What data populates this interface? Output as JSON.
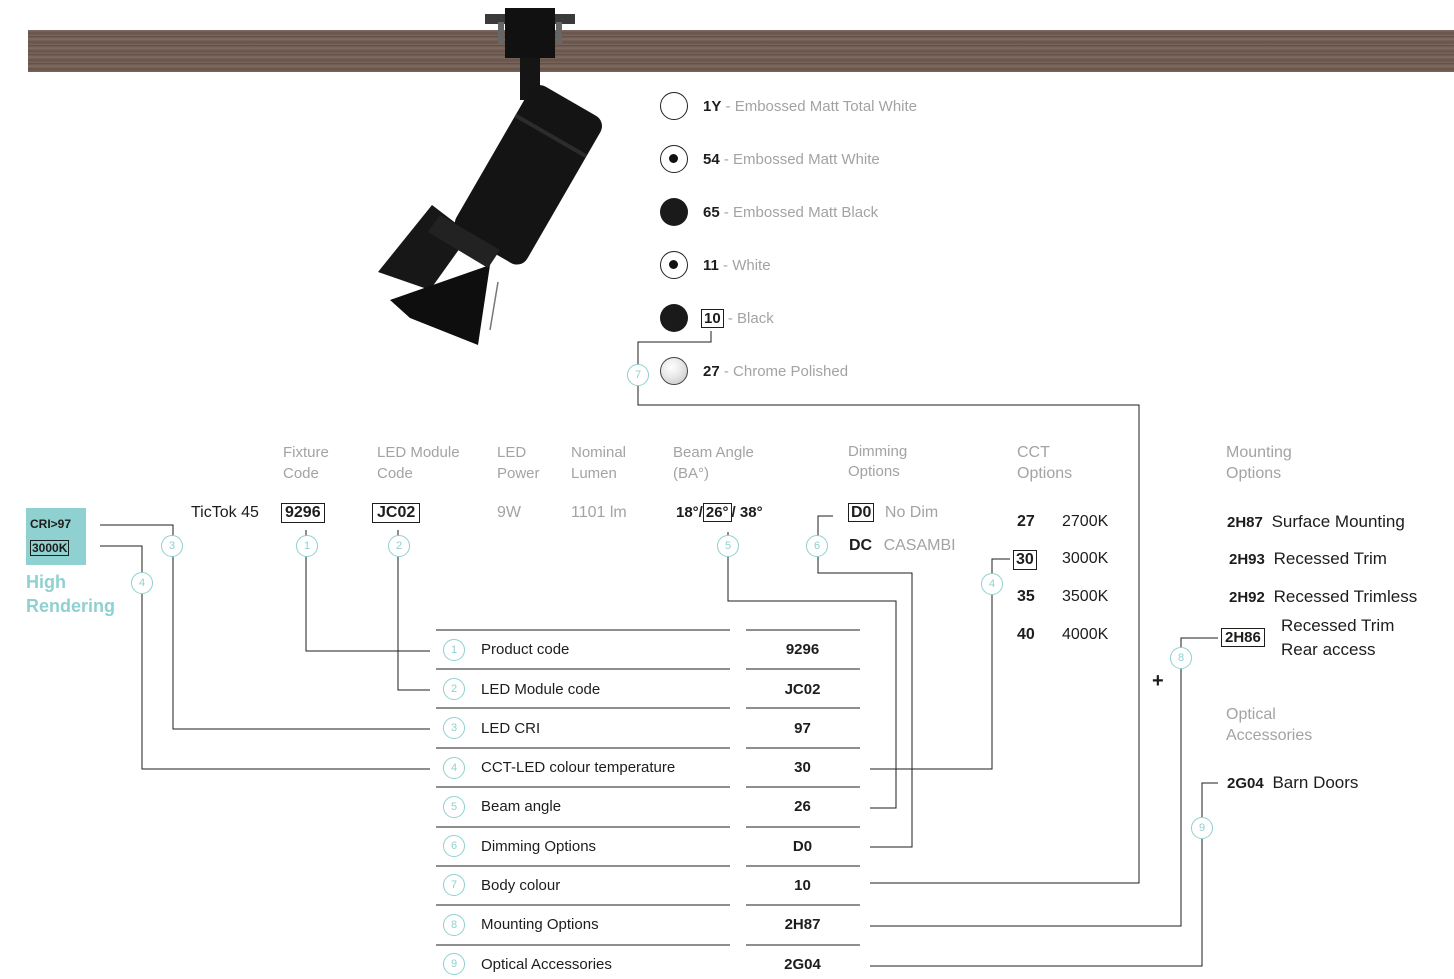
{
  "colours": [
    {
      "code": "1Y",
      "sep": "-",
      "name": "Embossed Matt Total White",
      "swatch": "white"
    },
    {
      "code": "54",
      "sep": "-",
      "name": "Embossed Matt White",
      "swatch": "dot"
    },
    {
      "code": "65",
      "sep": "-",
      "name": "Embossed Matt Black",
      "swatch": "black"
    },
    {
      "code": "11",
      "sep": "-",
      "name": "White",
      "swatch": "dot"
    },
    {
      "code": "10",
      "sep": "-",
      "name": "Black",
      "swatch": "black",
      "boxed": true
    },
    {
      "code": "27",
      "sep": "-",
      "name": "Chrome Polished",
      "swatch": "chrome"
    }
  ],
  "headers": {
    "fixture_code": [
      "Fixture",
      "Code"
    ],
    "led_module_code": [
      "LED Module",
      "Code"
    ],
    "led_power": [
      "LED",
      "Power"
    ],
    "nominal_lumen": [
      "Nominal",
      "Lumen"
    ],
    "beam_angle": [
      "Beam Angle",
      "(BA°)"
    ],
    "dimming_options": [
      "Dimming",
      "Options"
    ],
    "cct_options": [
      "CCT",
      "Options"
    ],
    "mounting_options": [
      "Mounting",
      "Options"
    ],
    "optical_accessories": [
      "Optical",
      "Accessories"
    ]
  },
  "product": {
    "name": "TicTok 45",
    "fixture_code": "9296",
    "led_module_code": "JC02",
    "led_power": "9W",
    "nominal_lumen": "1101 lm",
    "beam_a": "18°/",
    "beam_b": "26°",
    "beam_c": "/ 38°"
  },
  "cri": {
    "line1": "CRI>97",
    "line2": "3000K",
    "label1": "High",
    "label2": "Rendering"
  },
  "dimming": [
    {
      "code": "D0",
      "name": "No Dim"
    },
    {
      "code": "DC",
      "name": "CASAMBI"
    }
  ],
  "cct": [
    {
      "code": "27",
      "value": "2700K"
    },
    {
      "code": "30",
      "value": "3000K"
    },
    {
      "code": "35",
      "value": "3500K"
    },
    {
      "code": "40",
      "value": "4000K"
    }
  ],
  "mounting": [
    {
      "code": "2H87",
      "name": "Surface Mounting"
    },
    {
      "code": "2H93",
      "name": "Recessed Trim"
    },
    {
      "code": "2H92",
      "name": "Recessed Trimless"
    },
    {
      "code": "2H86",
      "name1": "Recessed Trim",
      "name2": "Rear access"
    }
  ],
  "plus": "+",
  "accessories": [
    {
      "code": "2G04",
      "name": "Barn Doors"
    }
  ],
  "circles": [
    "1",
    "2",
    "3",
    "4",
    "5",
    "6",
    "7",
    "8",
    "9"
  ],
  "table": [
    {
      "num": "1",
      "label": "Product code",
      "value": "9296"
    },
    {
      "num": "2",
      "label": "LED Module code",
      "value": "JC02"
    },
    {
      "num": "3",
      "label": "LED CRI",
      "value": "97"
    },
    {
      "num": "4",
      "label": "CCT-LED colour temperature",
      "value": "30"
    },
    {
      "num": "5",
      "label": "Beam angle",
      "value": "26"
    },
    {
      "num": "6",
      "label": "Dimming Options",
      "value": "D0"
    },
    {
      "num": "7",
      "label": "Body colour",
      "value": "10"
    },
    {
      "num": "8",
      "label": "Mounting Options",
      "value": "2H87"
    },
    {
      "num": "9",
      "label": "Optical Accessories",
      "value": "2G04"
    }
  ],
  "colors": {
    "accent": "#8fd0d0",
    "text": "#1d1d1b",
    "muted": "#a3a3a3",
    "wood": "#6d5a52"
  }
}
